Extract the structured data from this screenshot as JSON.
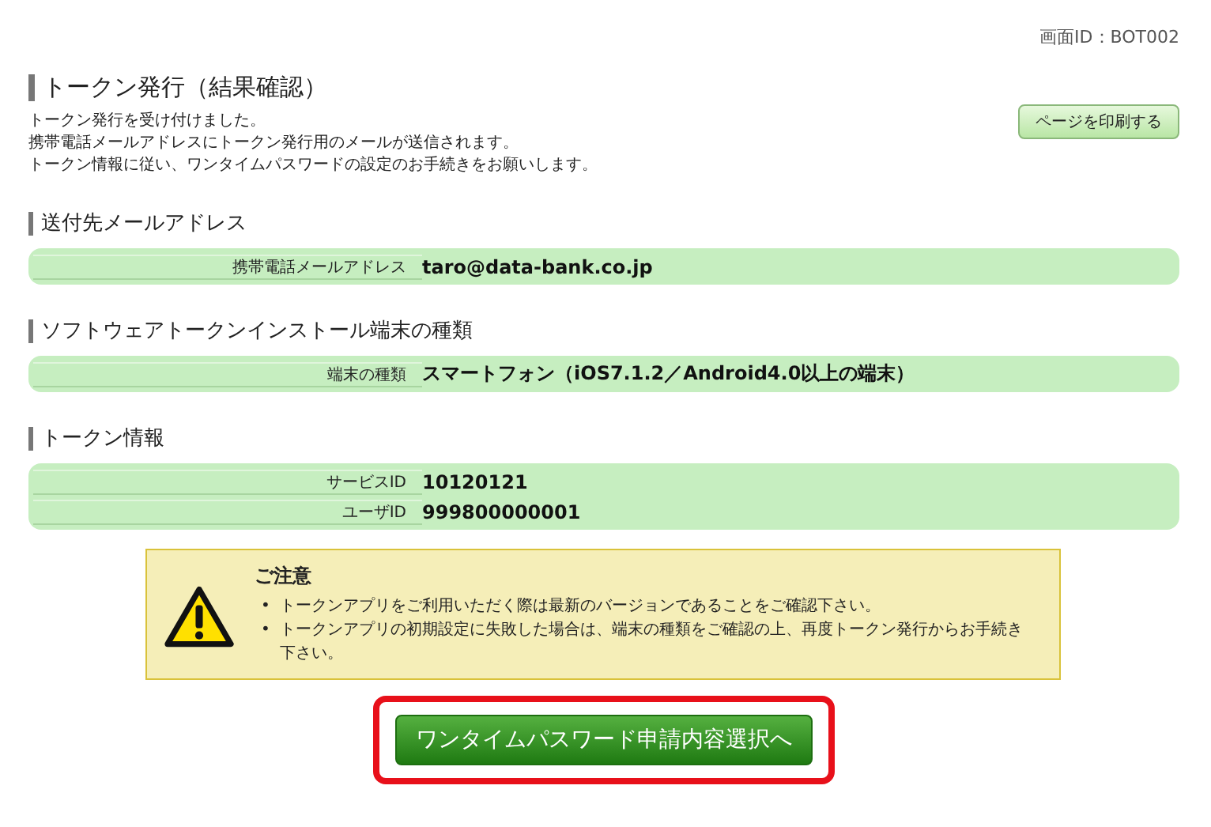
{
  "screen_id": "画面ID：BOT002",
  "page_title": "トークン発行（結果確認）",
  "print_button": "ページを印刷する",
  "intro_lines": [
    "トークン発行を受け付けました。",
    "携帯電話メールアドレスにトークン発行用のメールが送信されます。",
    "トークン情報に従い、ワンタイムパスワードの設定のお手続きをお願いします。"
  ],
  "sections": [
    {
      "title": "送付先メールアドレス",
      "rows": [
        {
          "label": "携帯電話メールアドレス",
          "value": "taro@data-bank.co.jp"
        }
      ]
    },
    {
      "title": "ソフトウェアトークンインストール端末の種類",
      "rows": [
        {
          "label": "端末の種類",
          "value": "スマートフォン（iOS7.1.2／Android4.0以上の端末）"
        }
      ]
    },
    {
      "title": "トークン情報",
      "rows": [
        {
          "label": "サービスID",
          "value": "10120121"
        },
        {
          "label": "ユーザID",
          "value": "999800000001"
        }
      ]
    }
  ],
  "notice": {
    "title": "ご注意",
    "items": [
      {
        "bullet": "•",
        "text": "トークンアプリをご利用いただく際は最新のバージョンであることをご確認下さい。"
      },
      {
        "bullet": "•",
        "text": "トークンアプリの初期設定に失敗した場合は、端末の種類をご確認の上、再度トークン発行からお手続き下さい。"
      }
    ]
  },
  "next_button": {
    "label": "ワンタイムパスワード申請内容選択へ",
    "highlighted": true
  }
}
